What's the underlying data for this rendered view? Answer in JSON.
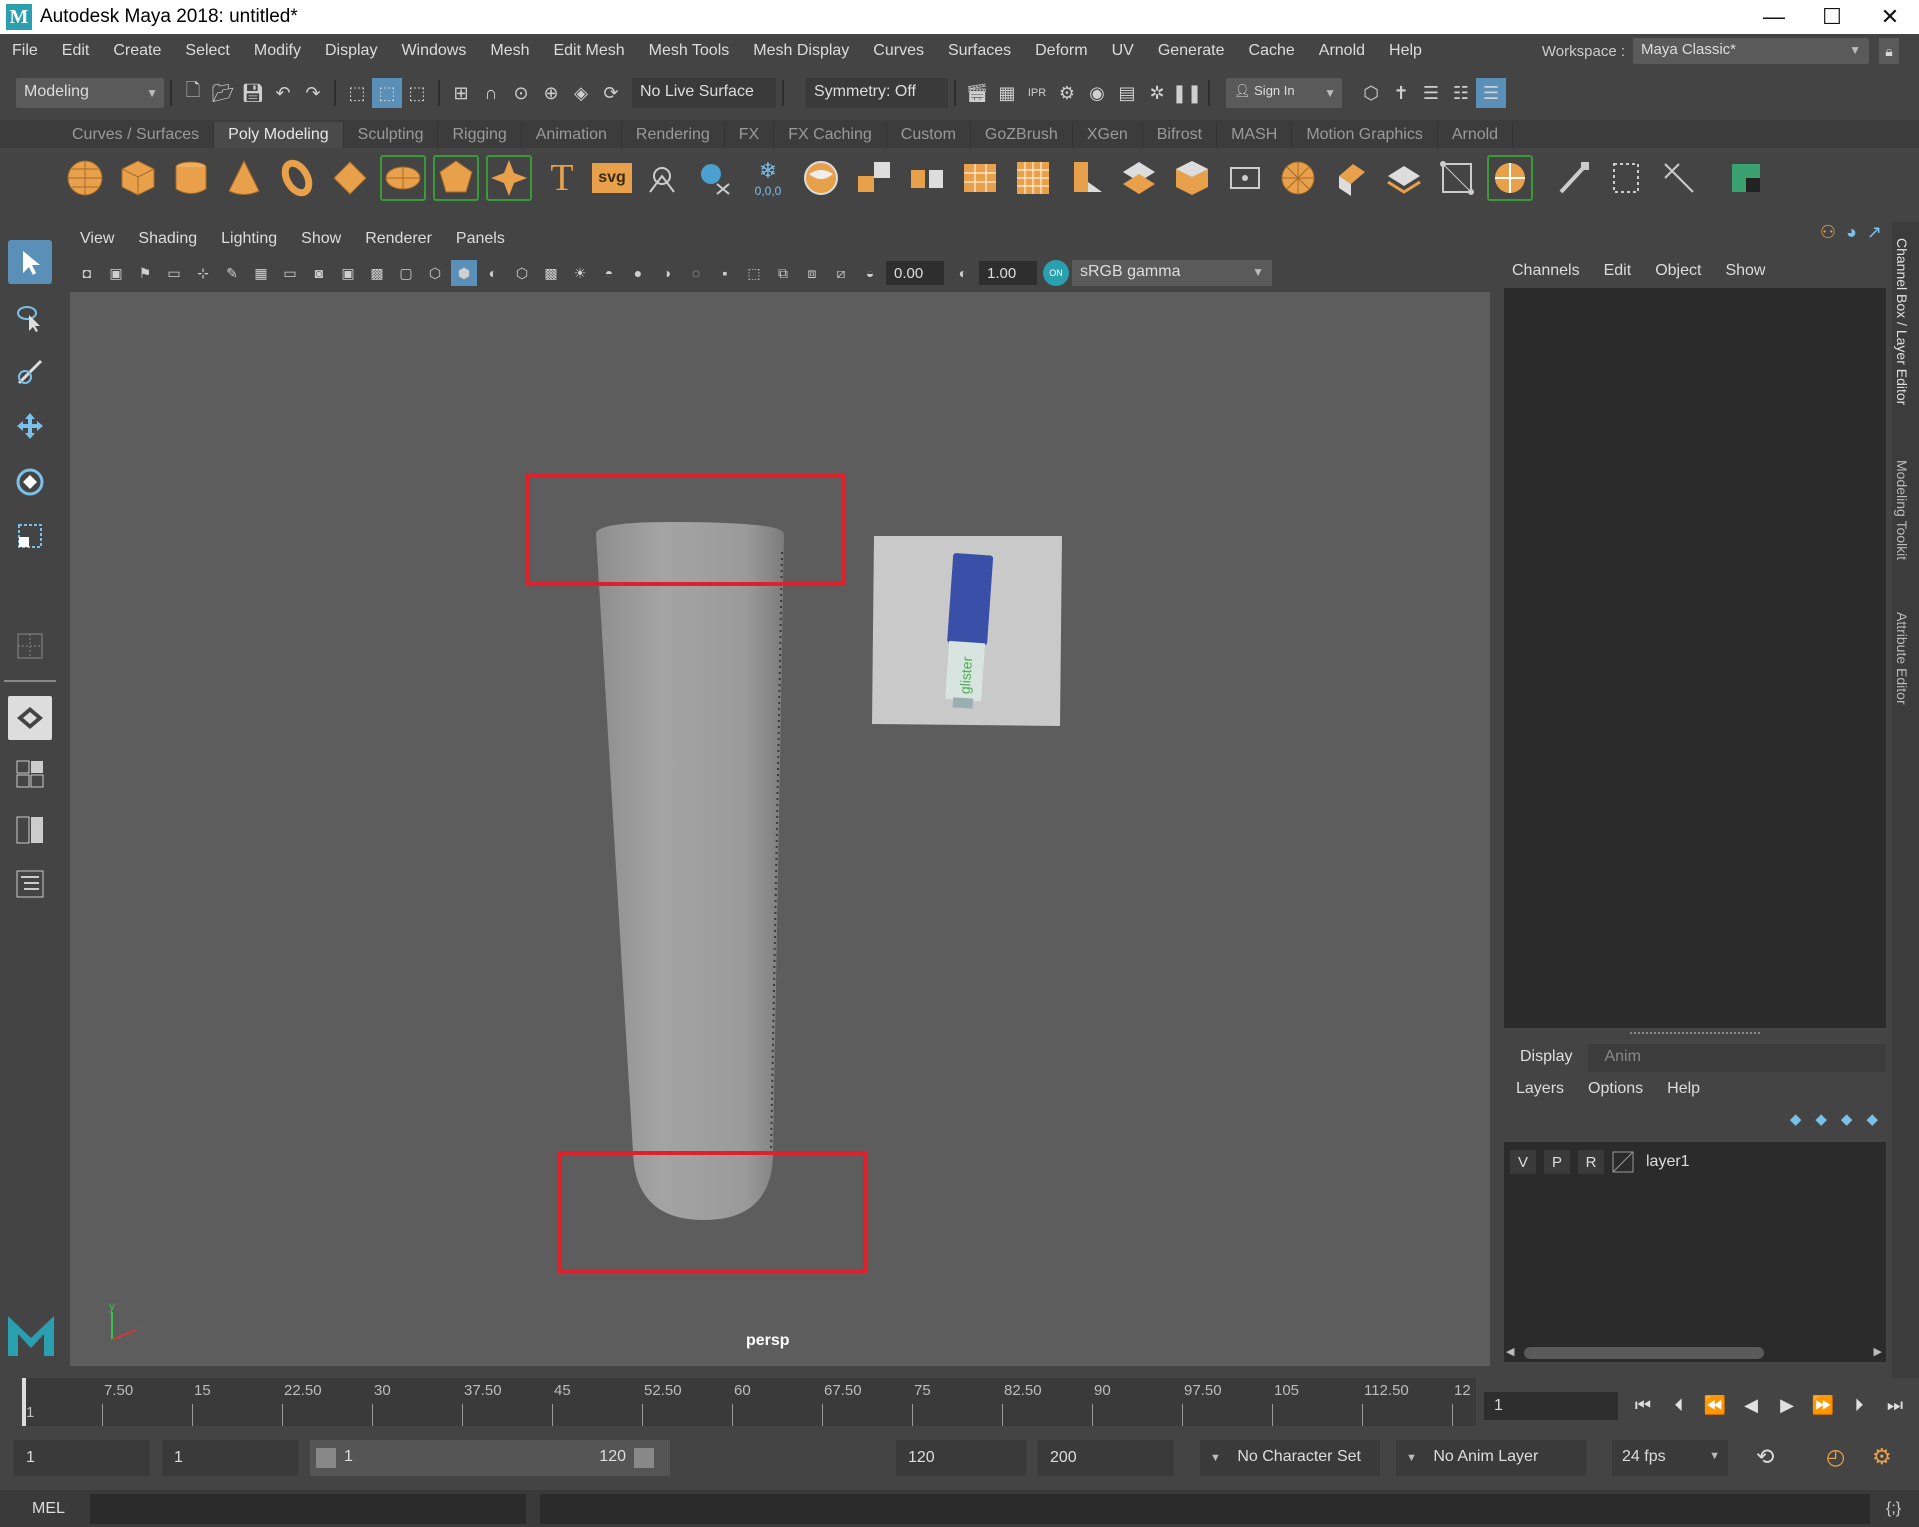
{
  "window": {
    "app_logo": "M",
    "title": "Autodesk Maya 2018: untitled*",
    "minimize": "—",
    "maximize": "☐",
    "close": "✕"
  },
  "menubar": {
    "items": [
      "File",
      "Edit",
      "Create",
      "Select",
      "Modify",
      "Display",
      "Windows",
      "Mesh",
      "Edit Mesh",
      "Mesh Tools",
      "Mesh Display",
      "Curves",
      "Surfaces",
      "Deform",
      "UV",
      "Generate",
      "Cache",
      "Arnold",
      "Help"
    ],
    "workspace_label": "Workspace :",
    "workspace_value": "Maya Classic*"
  },
  "statusline": {
    "menuset": "Modeling",
    "live_surface": "No Live Surface",
    "symmetry": "Symmetry: Off",
    "sign_in": "Sign In"
  },
  "shelf": {
    "tabs": [
      "Curves / Surfaces",
      "Poly Modeling",
      "Sculpting",
      "Rigging",
      "Animation",
      "Rendering",
      "FX",
      "FX Caching",
      "Custom",
      "GoZBrush",
      "XGen",
      "Bifrost",
      "MASH",
      "Motion Graphics",
      "Arnold"
    ],
    "active_tab": "Poly Modeling",
    "text_icon": "T",
    "svg_icon": "svg",
    "snowflake_value": "0,0,0"
  },
  "viewport": {
    "menu": [
      "View",
      "Shading",
      "Lighting",
      "Show",
      "Renderer",
      "Panels"
    ],
    "exposure": "0.00",
    "gamma": "1.00",
    "color_space": "sRGB gamma",
    "camera": "persp",
    "axis_y": "y",
    "axis_x": "x",
    "axis_z": "z",
    "ref_image_brand": "glister"
  },
  "channelbox": {
    "menu": [
      "Channels",
      "Edit",
      "Object",
      "Show"
    ]
  },
  "layereditor": {
    "tabs": [
      "Display",
      "Anim"
    ],
    "active_tab": "Display",
    "menu": [
      "Layers",
      "Options",
      "Help"
    ],
    "layer": {
      "v": "V",
      "p": "P",
      "r": "R",
      "name": "layer1"
    }
  },
  "sidetabs": [
    "Channel Box / Layer Editor",
    "Modeling Toolkit",
    "Attribute Editor"
  ],
  "timeslider": {
    "ticks": [
      "7.50",
      "15",
      "22.50",
      "30",
      "37.50",
      "45",
      "52.50",
      "60",
      "67.50",
      "75",
      "82.50",
      "90",
      "97.50",
      "105",
      "112.50",
      "12"
    ],
    "first_tick": "1",
    "current_frame": "1"
  },
  "rangeslider": {
    "start": "1",
    "playback_start": "1",
    "range_start": "1",
    "range_end": "120",
    "playback_end": "120",
    "end": "200",
    "character_set": "No Character Set",
    "anim_layer": "No Anim Layer",
    "fps": "24 fps"
  },
  "cmdline": {
    "label": "MEL"
  },
  "colors": {
    "accent_orange": "#e8a04a",
    "highlight_red": "#e0202a",
    "active_blue": "#5a8fb8",
    "maya_teal": "#2a9fb0"
  }
}
